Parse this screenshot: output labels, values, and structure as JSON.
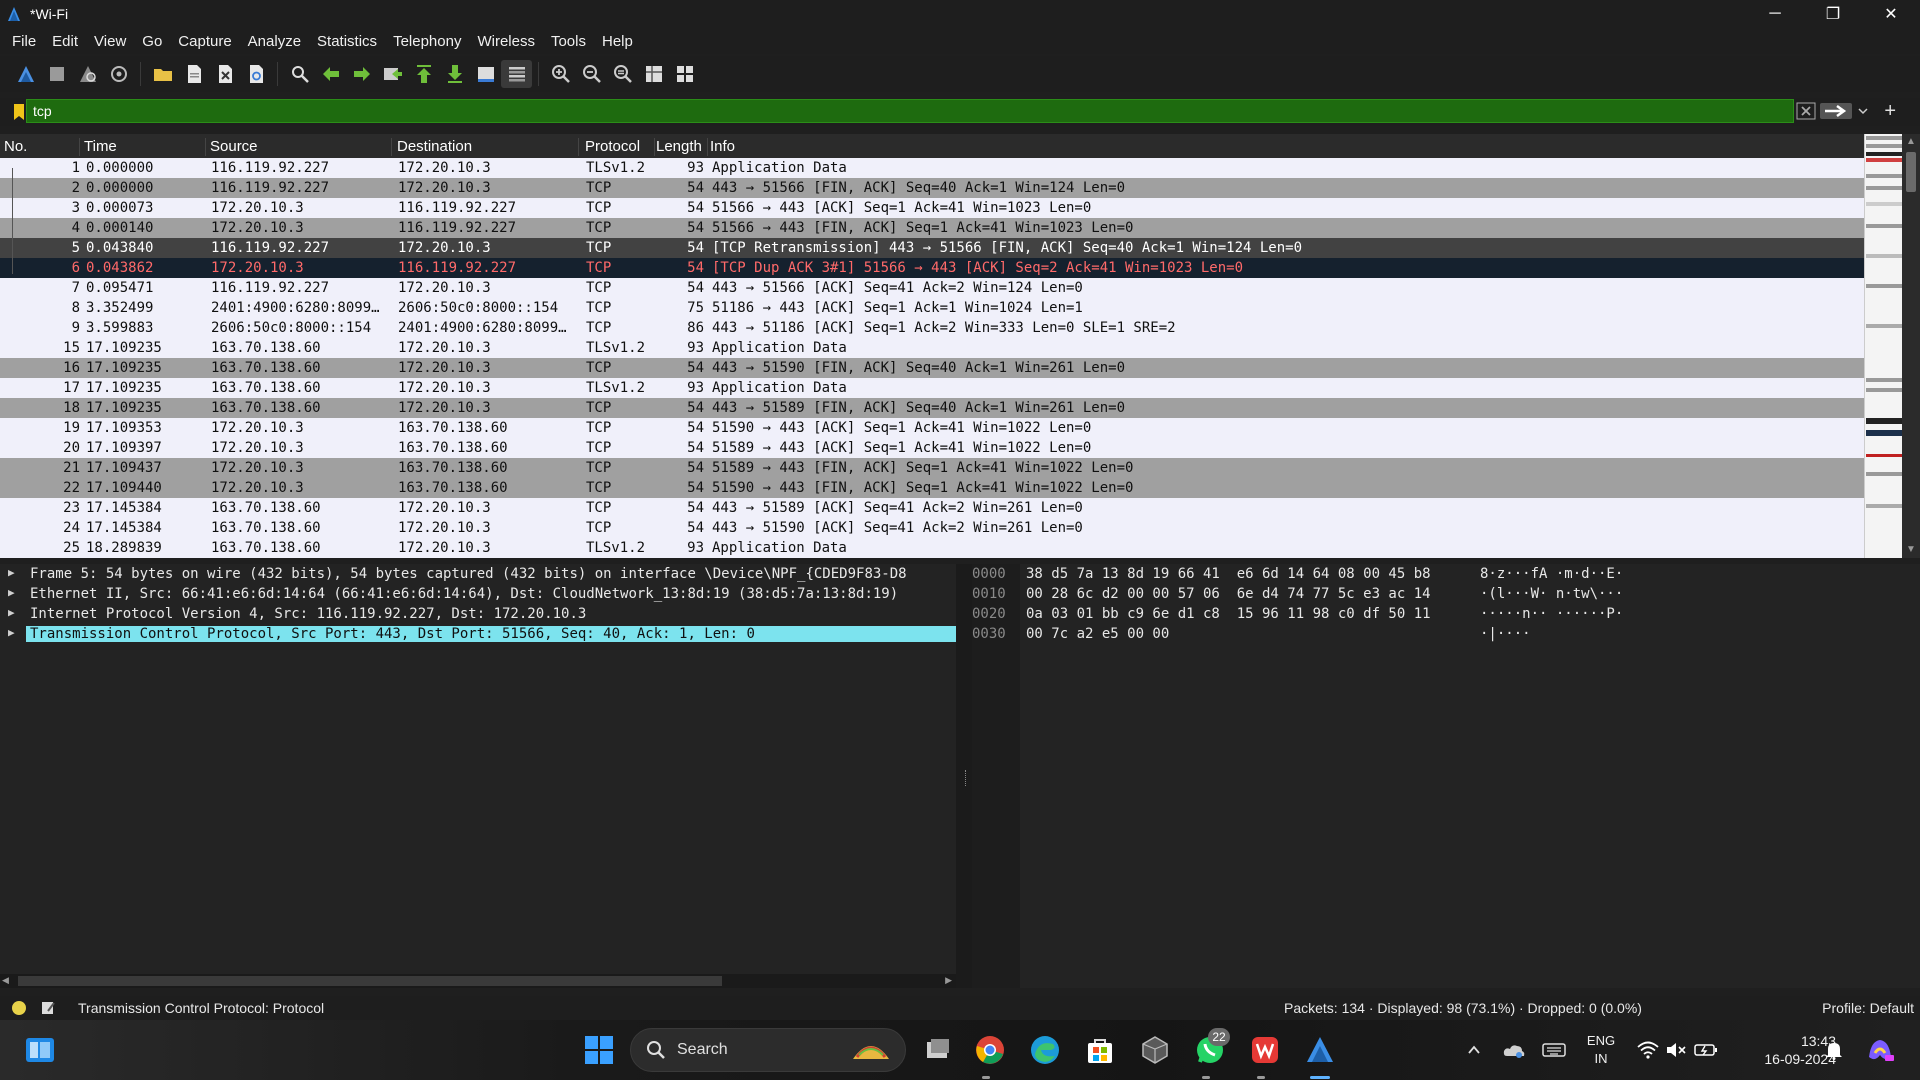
{
  "window": {
    "title": "*Wi-Fi",
    "minimize": "─",
    "maximize": "❐",
    "close": "✕"
  },
  "menu": [
    "File",
    "Edit",
    "View",
    "Go",
    "Capture",
    "Analyze",
    "Statistics",
    "Telephony",
    "Wireless",
    "Tools",
    "Help"
  ],
  "toolbar": {
    "icons": [
      "shark-fin-start-icon",
      "stop-capture-icon",
      "restart-capture-icon",
      "capture-options-icon",
      "open-file-icon",
      "save-file-icon",
      "close-file-icon",
      "reload-file-icon",
      "find-packet-icon",
      "go-back-icon",
      "go-forward-icon",
      "go-to-packet-icon",
      "go-first-icon",
      "go-last-icon",
      "auto-scroll-icon",
      "colorize-icon",
      "zoom-in-icon",
      "zoom-out-icon",
      "zoom-normal-icon",
      "resize-columns-icon",
      "layout-icon"
    ]
  },
  "filter": {
    "value": "tcp",
    "plus": "+"
  },
  "columns": [
    "No.",
    "Time",
    "Source",
    "Destination",
    "Protocol",
    "Length",
    "Info"
  ],
  "packets": [
    {
      "no": "1",
      "time": "0.000000",
      "src": "116.119.92.227",
      "dst": "172.20.10.3",
      "proto": "TLSv1.2",
      "len": "93",
      "info": "Application Data",
      "style": "white"
    },
    {
      "no": "2",
      "time": "0.000000",
      "src": "116.119.92.227",
      "dst": "172.20.10.3",
      "proto": "TCP",
      "len": "54",
      "info": "443 → 51566 [FIN, ACK] Seq=40 Ack=1 Win=124 Len=0",
      "style": "gray"
    },
    {
      "no": "3",
      "time": "0.000073",
      "src": "172.20.10.3",
      "dst": "116.119.92.227",
      "proto": "TCP",
      "len": "54",
      "info": "51566 → 443 [ACK] Seq=1 Ack=41 Win=1023 Len=0",
      "style": "white"
    },
    {
      "no": "4",
      "time": "0.000140",
      "src": "172.20.10.3",
      "dst": "116.119.92.227",
      "proto": "TCP",
      "len": "54",
      "info": "51566 → 443 [FIN, ACK] Seq=1 Ack=41 Win=1023 Len=0",
      "style": "gray"
    },
    {
      "no": "5",
      "time": "0.043840",
      "src": "116.119.92.227",
      "dst": "172.20.10.3",
      "proto": "TCP",
      "len": "54",
      "info": "[TCP Retransmission] 443 → 51566 [FIN, ACK] Seq=40 Ack=1 Win=124 Len=0",
      "style": "dark"
    },
    {
      "no": "6",
      "time": "0.043862",
      "src": "172.20.10.3",
      "dst": "116.119.92.227",
      "proto": "TCP",
      "len": "54",
      "info": "[TCP Dup ACK 3#1] 51566 → 443 [ACK] Seq=2 Ack=41 Win=1023 Len=0",
      "style": "selected"
    },
    {
      "no": "7",
      "time": "0.095471",
      "src": "116.119.92.227",
      "dst": "172.20.10.3",
      "proto": "TCP",
      "len": "54",
      "info": "443 → 51566 [ACK] Seq=41 Ack=2 Win=124 Len=0",
      "style": "white"
    },
    {
      "no": "8",
      "time": "3.352499",
      "src": "2401:4900:6280:8099…",
      "dst": "2606:50c0:8000::154",
      "proto": "TCP",
      "len": "75",
      "info": "51186 → 443 [ACK] Seq=1 Ack=1 Win=1024 Len=1",
      "style": "white"
    },
    {
      "no": "9",
      "time": "3.599883",
      "src": "2606:50c0:8000::154",
      "dst": "2401:4900:6280:8099…",
      "proto": "TCP",
      "len": "86",
      "info": "443 → 51186 [ACK] Seq=1 Ack=2 Win=333 Len=0 SLE=1 SRE=2",
      "style": "white"
    },
    {
      "no": "15",
      "time": "17.109235",
      "src": "163.70.138.60",
      "dst": "172.20.10.3",
      "proto": "TLSv1.2",
      "len": "93",
      "info": "Application Data",
      "style": "white"
    },
    {
      "no": "16",
      "time": "17.109235",
      "src": "163.70.138.60",
      "dst": "172.20.10.3",
      "proto": "TCP",
      "len": "54",
      "info": "443 → 51590 [FIN, ACK] Seq=40 Ack=1 Win=261 Len=0",
      "style": "gray"
    },
    {
      "no": "17",
      "time": "17.109235",
      "src": "163.70.138.60",
      "dst": "172.20.10.3",
      "proto": "TLSv1.2",
      "len": "93",
      "info": "Application Data",
      "style": "white"
    },
    {
      "no": "18",
      "time": "17.109235",
      "src": "163.70.138.60",
      "dst": "172.20.10.3",
      "proto": "TCP",
      "len": "54",
      "info": "443 → 51589 [FIN, ACK] Seq=40 Ack=1 Win=261 Len=0",
      "style": "gray"
    },
    {
      "no": "19",
      "time": "17.109353",
      "src": "172.20.10.3",
      "dst": "163.70.138.60",
      "proto": "TCP",
      "len": "54",
      "info": "51590 → 443 [ACK] Seq=1 Ack=41 Win=1022 Len=0",
      "style": "white"
    },
    {
      "no": "20",
      "time": "17.109397",
      "src": "172.20.10.3",
      "dst": "163.70.138.60",
      "proto": "TCP",
      "len": "54",
      "info": "51589 → 443 [ACK] Seq=1 Ack=41 Win=1022 Len=0",
      "style": "white"
    },
    {
      "no": "21",
      "time": "17.109437",
      "src": "172.20.10.3",
      "dst": "163.70.138.60",
      "proto": "TCP",
      "len": "54",
      "info": "51589 → 443 [FIN, ACK] Seq=1 Ack=41 Win=1022 Len=0",
      "style": "gray"
    },
    {
      "no": "22",
      "time": "17.109440",
      "src": "172.20.10.3",
      "dst": "163.70.138.60",
      "proto": "TCP",
      "len": "54",
      "info": "51590 → 443 [FIN, ACK] Seq=1 Ack=41 Win=1022 Len=0",
      "style": "gray"
    },
    {
      "no": "23",
      "time": "17.145384",
      "src": "163.70.138.60",
      "dst": "172.20.10.3",
      "proto": "TCP",
      "len": "54",
      "info": "443 → 51589 [ACK] Seq=41 Ack=2 Win=261 Len=0",
      "style": "white"
    },
    {
      "no": "24",
      "time": "17.145384",
      "src": "163.70.138.60",
      "dst": "172.20.10.3",
      "proto": "TCP",
      "len": "54",
      "info": "443 → 51590 [ACK] Seq=41 Ack=2 Win=261 Len=0",
      "style": "white"
    },
    {
      "no": "25",
      "time": "18.289839",
      "src": "163.70.138.60",
      "dst": "172.20.10.3",
      "proto": "TLSv1.2",
      "len": "93",
      "info": "Application Data",
      "style": "white"
    }
  ],
  "details": [
    {
      "text": "Frame 5: 54 bytes on wire (432 bits), 54 bytes captured (432 bits) on interface \\Device\\NPF_{CDED9F83-D8",
      "highlight": false
    },
    {
      "text": "Ethernet II, Src: 66:41:e6:6d:14:64 (66:41:e6:6d:14:64), Dst: CloudNetwork_13:8d:19 (38:d5:7a:13:8d:19)",
      "highlight": false
    },
    {
      "text": "Internet Protocol Version 4, Src: 116.119.92.227, Dst: 172.20.10.3",
      "highlight": false
    },
    {
      "text": "Transmission Control Protocol, Src Port: 443, Dst Port: 51566, Seq: 40, Ack: 1, Len: 0",
      "highlight": true
    }
  ],
  "bytes": [
    {
      "off": "0000",
      "hex": "38 d5 7a 13 8d 19 66 41  e6 6d 14 64 08 00 45 b8",
      "ascii": "8·z···fA ·m·d··E·"
    },
    {
      "off": "0010",
      "hex": "00 28 6c d2 00 00 57 06  6e d4 74 77 5c e3 ac 14",
      "ascii": "·(l···W· n·tw\\···"
    },
    {
      "off": "0020",
      "hex": "0a 03 01 bb c9 6e d1 c8  15 96 11 98 c0 df 50 11",
      "ascii": "·····n·· ······P·"
    },
    {
      "off": "0030",
      "hex": "00 7c a2 e5 00 00",
      "ascii": "·|····"
    }
  ],
  "status": {
    "text": "Transmission Control Protocol: Protocol",
    "packets": "Packets: 134 · Displayed: 98 (73.1%) · Dropped: 0 (0.0%)",
    "profile": "Profile: Default"
  },
  "taskbar": {
    "search": "Search",
    "whatsapp_badge": "22",
    "lang_top": "ENG",
    "lang_bottom": "IN",
    "time": "13:43",
    "date": "16-09-2024"
  },
  "colors": {
    "filter_bg": "#1e6b0f",
    "row_white": "#f0f0fa",
    "row_gray": "#a0a0a0",
    "row_dark": "#424242",
    "row_selected_bg": "#15212e",
    "row_selected_fg": "#ff6a6a",
    "detail_highlight": "#7ce3ee"
  }
}
